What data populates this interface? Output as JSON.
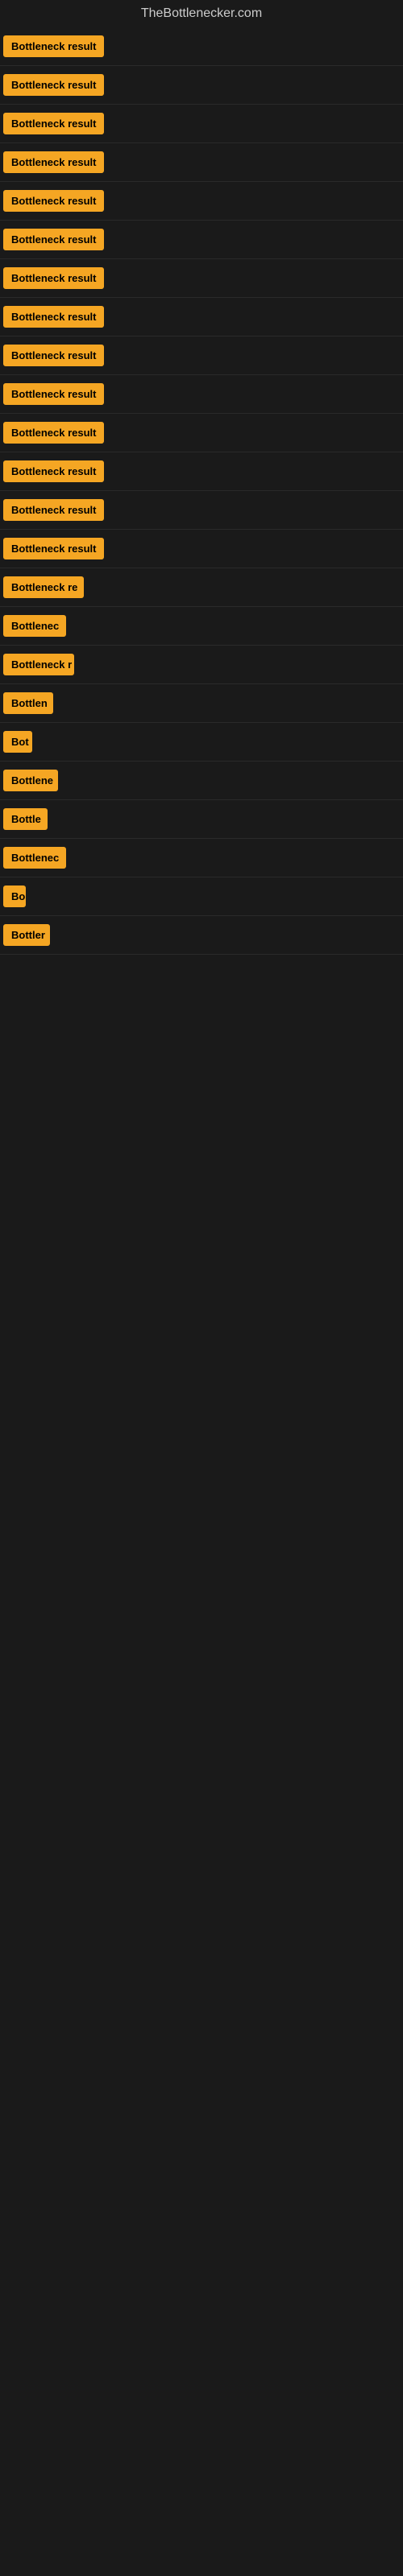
{
  "site": {
    "title": "TheBottlenecker.com"
  },
  "items": [
    {
      "id": 1,
      "label": "Bottleneck result",
      "width": 130
    },
    {
      "id": 2,
      "label": "Bottleneck result",
      "width": 130
    },
    {
      "id": 3,
      "label": "Bottleneck result",
      "width": 130
    },
    {
      "id": 4,
      "label": "Bottleneck result",
      "width": 130
    },
    {
      "id": 5,
      "label": "Bottleneck result",
      "width": 130
    },
    {
      "id": 6,
      "label": "Bottleneck result",
      "width": 130
    },
    {
      "id": 7,
      "label": "Bottleneck result",
      "width": 130
    },
    {
      "id": 8,
      "label": "Bottleneck result",
      "width": 130
    },
    {
      "id": 9,
      "label": "Bottleneck result",
      "width": 130
    },
    {
      "id": 10,
      "label": "Bottleneck result",
      "width": 130
    },
    {
      "id": 11,
      "label": "Bottleneck result",
      "width": 130
    },
    {
      "id": 12,
      "label": "Bottleneck result",
      "width": 130
    },
    {
      "id": 13,
      "label": "Bottleneck result",
      "width": 130
    },
    {
      "id": 14,
      "label": "Bottleneck result",
      "width": 130
    },
    {
      "id": 15,
      "label": "Bottleneck re",
      "width": 100
    },
    {
      "id": 16,
      "label": "Bottlenec",
      "width": 78
    },
    {
      "id": 17,
      "label": "Bottleneck r",
      "width": 88
    },
    {
      "id": 18,
      "label": "Bottlen",
      "width": 62
    },
    {
      "id": 19,
      "label": "Bot",
      "width": 36
    },
    {
      "id": 20,
      "label": "Bottlene",
      "width": 68
    },
    {
      "id": 21,
      "label": "Bottle",
      "width": 55
    },
    {
      "id": 22,
      "label": "Bottlenec",
      "width": 78
    },
    {
      "id": 23,
      "label": "Bo",
      "width": 28
    },
    {
      "id": 24,
      "label": "Bottler",
      "width": 58
    }
  ]
}
